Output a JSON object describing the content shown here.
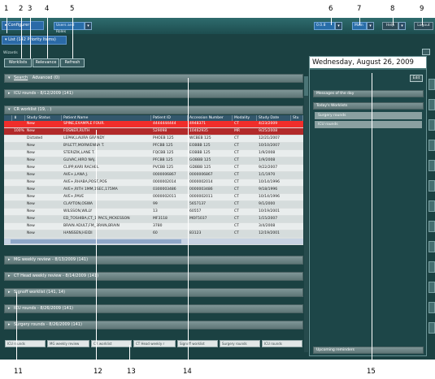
{
  "callouts_top": [
    "1",
    "2",
    "3",
    "4",
    "5",
    "6",
    "7",
    "8",
    "9"
  ],
  "callouts_bottom": [
    "11",
    "12",
    "13",
    "14",
    "15"
  ],
  "callout_right": "10",
  "toolbar": {
    "configurer": "▸ Configurer",
    "users_roles": "Users and Roles",
    "counter": "0.0.8",
    "main": "Main",
    "help": "Help",
    "logout": "Logout"
  },
  "list_bar": "▾ List (142 Priority Items)",
  "wizards": "Wizards",
  "tabs": [
    "Worklists",
    "Relevance",
    "Refresh"
  ],
  "search_bar": {
    "search": "Search",
    "advanced": "Advanced (0)"
  },
  "sections": {
    "icu_top": "ICU rounds - 8/12/2009 (141)",
    "cr": "CR worklist (19, . )",
    "mg": "MG weekly review - 8/13/2009 (141)",
    "ct": "CT Head weekly review - 8/14/2009 (141)",
    "signoff": "Signoff worklist (141, 14)",
    "icu": "ICU rounds - 8/26/2009 (141)",
    "surgery": "Surgery rounds - 8/26/2009 (141)"
  },
  "grid": {
    "columns": [
      "",
      "",
      "Study Status",
      "Patient Name",
      "Patient ID",
      "Accession Number",
      "Modality",
      "Study Date",
      "Stu"
    ],
    "rows": [
      [
        "",
        "",
        "New",
        "SPINE,EXAMPLE FOUR.",
        "4444444444",
        "4948371",
        "CT",
        "4/23/2009",
        ""
      ],
      [
        "",
        "100%",
        "New",
        "FOSNER,RUTH",
        "529098",
        "10462935",
        "MR",
        "9/25/2008",
        ""
      ],
      [
        "",
        "",
        "Dictated",
        "LEPAK,LAURA GRANDY",
        "PHOEB 125",
        "WCBEB 125",
        "CT",
        "12/21/2007",
        ""
      ],
      [
        "",
        "",
        "New",
        "BYLETT,MORWENNA T.",
        "PFCBB 125",
        "EOBBB 125",
        "CT",
        "10/10/2007",
        ""
      ],
      [
        "",
        "",
        "New",
        "STERIZIK,LANE T.",
        "FQCBB 125",
        "EOBBB 125",
        "CT",
        "1/9/2008",
        ""
      ],
      [
        "",
        "",
        "New",
        "GLIVAC,HIRO NAJ.",
        "PFCBB 125",
        "GOBBB 125",
        "CT",
        "1/9/2008",
        ""
      ],
      [
        "",
        "",
        "New",
        "CLIPP,KARI RACHEL",
        "PVCBB 125",
        "GDBBB 125",
        "CT",
        "9/22/2007",
        ""
      ],
      [
        "",
        "",
        "New",
        "AVE+,LANA J.",
        "0000006867",
        "0000006867",
        "CT",
        "1/1/1970",
        ""
      ],
      [
        "",
        "",
        "New",
        "AVE+,RHABA,POST,POS",
        "0000002014",
        "0000002014",
        "CT",
        "10/14/1996",
        ""
      ],
      [
        "",
        "",
        "New",
        "AVE+,RITH 1MM,1SEC,175MA",
        "0300003486",
        "0000003486",
        "CT",
        "9/18/1996",
        ""
      ],
      [
        "",
        "",
        "New",
        "AVE+,PAVE",
        "0000002011",
        "0000002011",
        "CT",
        "10/14/1996",
        ""
      ],
      [
        "",
        "",
        "New",
        "CLAYTON,OSWA",
        "99",
        "5657137",
        "CT",
        "9/1/2000",
        ""
      ],
      [
        "",
        "",
        "New",
        "WILSSON,WILLY",
        "13",
        "60557",
        "CT",
        "10/19/2001",
        ""
      ],
      [
        "",
        "",
        "New",
        "ED_TOSHIBA,CT_1 PACS_MCKESSON",
        "MF3118",
        "MOF5037",
        "CT",
        "1/15/2007",
        ""
      ],
      [
        "",
        "",
        "New",
        "BRAIN ADULT,FM_BRAIN,BRAIN",
        "3780",
        "",
        "CT",
        "3/4/2008",
        ""
      ],
      [
        "",
        "",
        "New",
        "HANSSEN,HEIDI",
        "60",
        "83123",
        "CT",
        "12/19/2001",
        ""
      ]
    ]
  },
  "right_panel": {
    "date": "Wednesday, August 26, 2009",
    "edit": "Edit",
    "messages": "Messages of the day",
    "todays": "Today's Worklists",
    "items": [
      "Surgery rounds",
      "ICU rounds"
    ],
    "upcoming": "Upcoming reminders"
  },
  "bottom_tabs": [
    "ICU rounds",
    "MG weekly review",
    "CR worklist",
    "CT Head weekly r",
    "Signoff worklist",
    "Surgery rounds",
    "ICU rounds"
  ],
  "colors": {
    "highlight": "#f02e2b",
    "highlight2": "#b22a2a",
    "bg": "#1b4142",
    "blue": "#2b6aa7"
  }
}
